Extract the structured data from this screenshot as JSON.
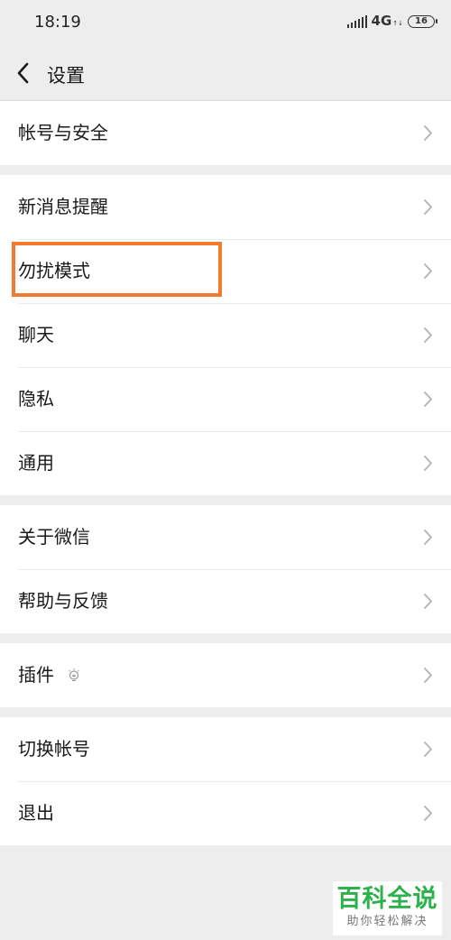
{
  "status_bar": {
    "time": "18:19",
    "network": "4G",
    "network_sub": "↑↓",
    "battery": "16"
  },
  "nav": {
    "title": "设置"
  },
  "groups": [
    {
      "items": [
        {
          "label": "帐号与安全"
        }
      ]
    },
    {
      "items": [
        {
          "label": "新消息提醒"
        },
        {
          "label": "勿扰模式"
        },
        {
          "label": "聊天"
        },
        {
          "label": "隐私"
        },
        {
          "label": "通用"
        }
      ]
    },
    {
      "items": [
        {
          "label": "关于微信"
        },
        {
          "label": "帮助与反馈"
        }
      ]
    },
    {
      "items": [
        {
          "label": "插件"
        }
      ]
    },
    {
      "items": [
        {
          "label": "切换帐号"
        },
        {
          "label": "退出"
        }
      ]
    }
  ],
  "highlight": {
    "color": "#f47a32",
    "target": "勿扰模式"
  },
  "watermark": {
    "main": "百科全说",
    "sub": "助你轻松解决",
    "color": "#2cb24a"
  },
  "icons": {
    "back": "chevron-left-icon",
    "row_arrow": "chevron-right-icon",
    "plugin_badge": "bulb-icon",
    "signal": "signal-icon",
    "battery": "battery-icon"
  }
}
